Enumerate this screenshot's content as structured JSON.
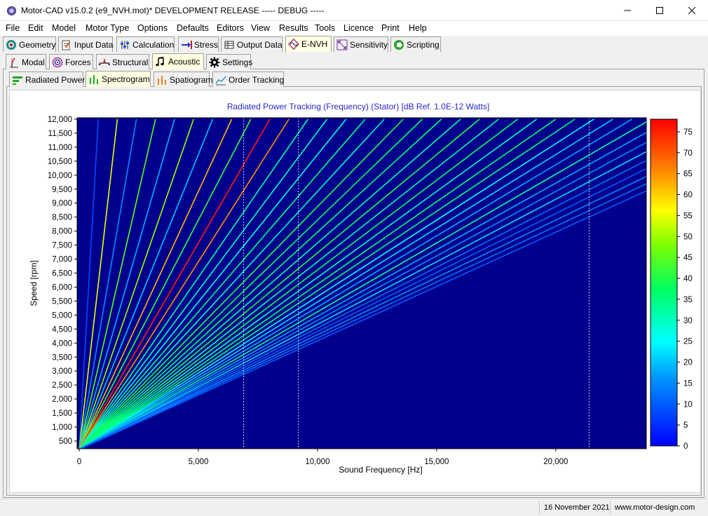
{
  "window": {
    "title": "Motor-CAD v15.0.2 (e9_NVH.mot)* DEVELOPMENT RELEASE ----- DEBUG -----",
    "minimize_icon": "minimize-icon",
    "maximize_icon": "maximize-icon",
    "close_icon": "close-icon"
  },
  "menu": [
    "File",
    "Edit",
    "Model",
    "Motor Type",
    "Options",
    "Defaults",
    "Editors",
    "View",
    "Results",
    "Tools",
    "Licence",
    "Print",
    "Help"
  ],
  "main_tabs": [
    {
      "label": "Geometry",
      "icon": "geometry-icon"
    },
    {
      "label": "Input Data",
      "icon": "input-data-icon"
    },
    {
      "label": "Calculation",
      "icon": "calculation-icon"
    },
    {
      "label": "Stress",
      "icon": "stress-icon"
    },
    {
      "label": "Output Data",
      "icon": "output-data-icon"
    },
    {
      "label": "E-NVH",
      "icon": "envh-icon",
      "active": true
    },
    {
      "label": "Sensitivity",
      "icon": "sensitivity-icon"
    },
    {
      "label": "Scripting",
      "icon": "scripting-icon"
    }
  ],
  "envh_tabs": [
    {
      "label": "Modal",
      "icon": "modal-icon"
    },
    {
      "label": "Forces",
      "icon": "forces-icon"
    },
    {
      "label": "Structural",
      "icon": "structural-icon"
    },
    {
      "label": "Acoustic",
      "icon": "acoustic-icon",
      "active": true
    },
    {
      "label": "Settings",
      "icon": "settings-icon"
    }
  ],
  "acoustic_tabs": [
    {
      "label": "Radiated Power",
      "icon": "radiated-power-icon"
    },
    {
      "label": "Spectrogram",
      "icon": "spectrogram-icon",
      "active": true
    },
    {
      "label": "Spatiogram",
      "icon": "spatiogram-icon"
    },
    {
      "label": "Order Tracking",
      "icon": "order-tracking-icon"
    }
  ],
  "status": {
    "date": "16 November 2021",
    "website": "www.motor-design.com"
  },
  "chart_data": {
    "type": "heatmap",
    "title": "Radiated Power Tracking (Frequency) (Stator) [dB Ref. 1.0E-12 Watts]",
    "xlabel": "Sound Frequency [Hz]",
    "ylabel": "Speed [rpm]",
    "xlim": [
      0,
      23800
    ],
    "ylim": [
      200,
      12000
    ],
    "x_ticks": [
      0,
      5000,
      10000,
      15000,
      20000
    ],
    "x_tick_labels": [
      "0",
      "5,000",
      "10,000",
      "15,000",
      "20,000"
    ],
    "y_ticks": [
      500,
      1000,
      1500,
      2000,
      2500,
      3000,
      3500,
      4000,
      4500,
      5000,
      5500,
      6000,
      6500,
      7000,
      7500,
      8000,
      8500,
      9000,
      9500,
      10000,
      10500,
      11000,
      11500,
      12000
    ],
    "y_tick_labels": [
      "500",
      "1,000",
      "1,500",
      "2,000",
      "2,500",
      "3,000",
      "3,500",
      "4,000",
      "4,500",
      "5,000",
      "5,500",
      "6,000",
      "6,500",
      "7,000",
      "7,500",
      "8,000",
      "8,500",
      "9,000",
      "9,500",
      "10,000",
      "10,500",
      "11,000",
      "11,500",
      "12,000"
    ],
    "colorbar": {
      "min": 0,
      "max": 78,
      "ticks": [
        0,
        5,
        10,
        15,
        20,
        25,
        30,
        35,
        40,
        45,
        50,
        55,
        60,
        65,
        70,
        75
      ],
      "tick_labels": [
        "0",
        "5",
        "10",
        "15",
        "20",
        "25",
        "30",
        "35",
        "40",
        "45",
        "50",
        "55",
        "60",
        "65",
        "70",
        "75"
      ]
    },
    "background_color": "#00008c",
    "order_lines": {
      "description_units": "frequency [Hz] at 12,000 rpm for each order line (line passes through origin)",
      "freq_at_12000rpm": [
        800,
        1600,
        2400,
        3200,
        4000,
        4800,
        5600,
        6400,
        7200,
        8000,
        8800,
        9600,
        10400,
        11200,
        12000,
        12800,
        13600,
        14400,
        15200,
        16000,
        16800,
        17600,
        18400,
        19200,
        20000,
        20800,
        21600,
        22400,
        23200,
        24000,
        24800,
        25600,
        26400,
        27200,
        28000,
        28800,
        29600,
        30400
      ],
      "levels_db": [
        8,
        55,
        15,
        45,
        18,
        50,
        20,
        62,
        42,
        75,
        65,
        32,
        30,
        28,
        35,
        30,
        40,
        38,
        36,
        32,
        40,
        32,
        38,
        30,
        36,
        35,
        25,
        22,
        18,
        32,
        18,
        15,
        22,
        12,
        10,
        15,
        12,
        10
      ]
    },
    "vertical_markers_hz": [
      6900,
      9200,
      21400
    ]
  }
}
